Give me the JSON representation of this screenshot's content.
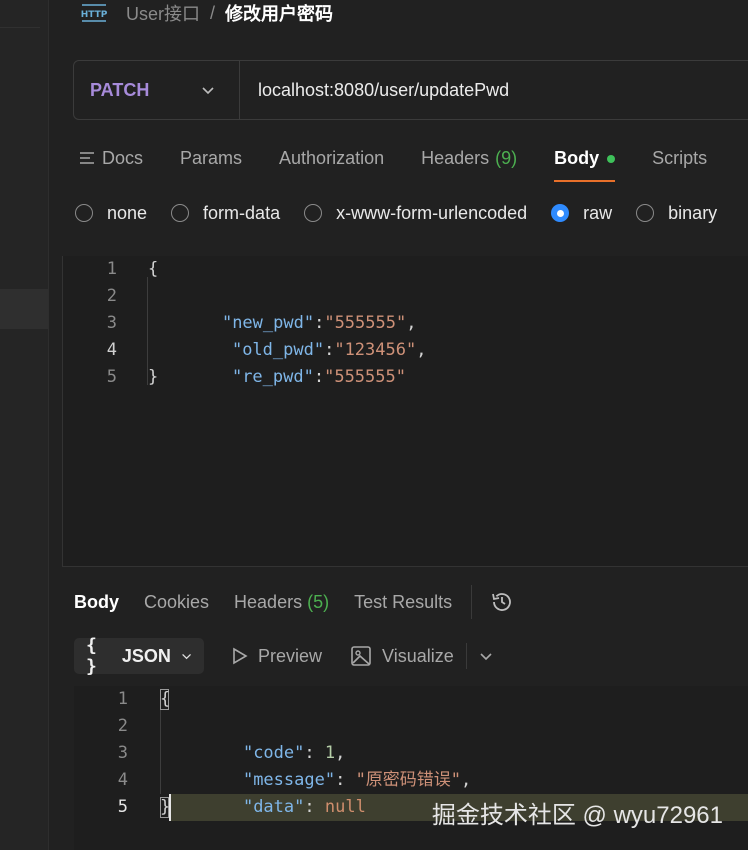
{
  "breadcrumb": {
    "http_icon_label": "HTTP",
    "parent": "User接口",
    "separator": "/",
    "current": "修改用户密码"
  },
  "request": {
    "method": "PATCH",
    "url": "localhost:8080/user/updatePwd"
  },
  "request_tabs": [
    {
      "label": "Docs"
    },
    {
      "label": "Params"
    },
    {
      "label": "Authorization"
    },
    {
      "label": "Headers",
      "count": "(9)"
    },
    {
      "label": "Body",
      "active": true
    },
    {
      "label": "Scripts"
    }
  ],
  "body_types": [
    "none",
    "form-data",
    "x-www-form-urlencoded",
    "raw",
    "binary"
  ],
  "body_type_selected": "raw",
  "request_body": {
    "line_numbers": [
      "1",
      "2",
      "3",
      "4",
      "5"
    ],
    "open": "{",
    "close": "}",
    "fields": [
      {
        "key": "\"new_pwd\"",
        "value": "\"555555\"",
        "suffix": ","
      },
      {
        "key": "\"old_pwd\"",
        "value": "\"123456\"",
        "suffix": ","
      },
      {
        "key": "\"re_pwd\"",
        "value": "\"555555\"",
        "suffix": ""
      }
    ]
  },
  "response_tabs": [
    {
      "label": "Body",
      "active": true
    },
    {
      "label": "Cookies"
    },
    {
      "label": "Headers",
      "count": "(5)"
    },
    {
      "label": "Test Results"
    }
  ],
  "response_toolbar": {
    "format_braces": "{ }",
    "format": "JSON",
    "preview": "Preview",
    "visualize": "Visualize"
  },
  "response_body": {
    "line_numbers": [
      "1",
      "2",
      "3",
      "4",
      "5"
    ],
    "open": "{",
    "close": "}",
    "code_key": "\"code\"",
    "code_val": "1",
    "message_key": "\"message\"",
    "message_val": "\"原密码错误\"",
    "data_key": "\"data\"",
    "data_val": "null"
  },
  "watermark": "掘金技术社区 @ wyu72961",
  "colors": {
    "background": "#212121",
    "method": "#a78bda",
    "active_underline": "#e8702a",
    "status_dot": "#3ec15a",
    "radio_selected": "#2f8bff",
    "json_key": "#7fb6e8",
    "json_string": "#ce9178"
  }
}
